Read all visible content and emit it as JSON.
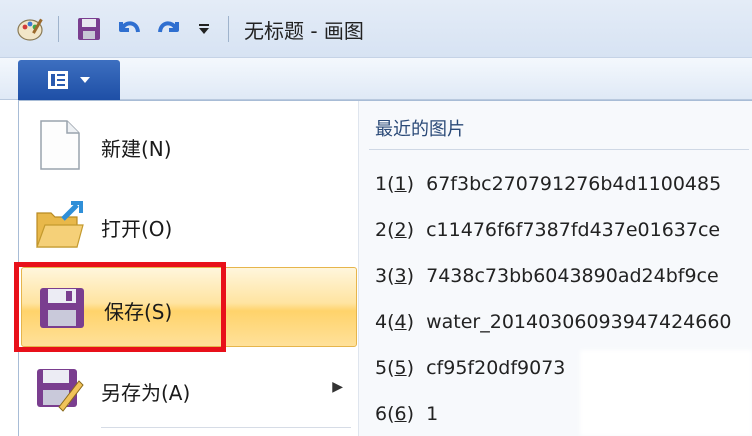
{
  "window": {
    "title": "无标题 - 画图"
  },
  "quick_access": {
    "icons": [
      "paint-icon",
      "save-icon",
      "undo-icon",
      "redo-icon",
      "customize-dropdown-icon"
    ]
  },
  "app_menu": {
    "icon": "menu-list-icon"
  },
  "menu": {
    "items": [
      {
        "label": "新建(N)",
        "icon": "new-file-icon"
      },
      {
        "label": "打开(O)",
        "icon": "open-folder-icon"
      },
      {
        "label": "保存(S)",
        "icon": "floppy-save-icon",
        "selected": true
      },
      {
        "label": "另存为(A)",
        "icon": "save-as-icon",
        "has_submenu": true
      }
    ]
  },
  "recent": {
    "title": "最近的图片",
    "items": [
      {
        "num": "1",
        "key": "1",
        "name": "67f3bc270791276b4d1100485"
      },
      {
        "num": "2",
        "key": "2",
        "name": "c11476f6f7387fd437e01637ce"
      },
      {
        "num": "3",
        "key": "3",
        "name": "7438c73bb6043890ad24bf9ce"
      },
      {
        "num": "4",
        "key": "4",
        "name": "water_20140306093947424660"
      },
      {
        "num": "5",
        "key": "5",
        "name": "cf95f20df9073"
      },
      {
        "num": "6",
        "key": "6",
        "name": "1"
      }
    ]
  },
  "colors": {
    "highlight": "#e8101a",
    "menu_button": "#2a5bb0",
    "selected_bg": "#ffe4a1"
  }
}
